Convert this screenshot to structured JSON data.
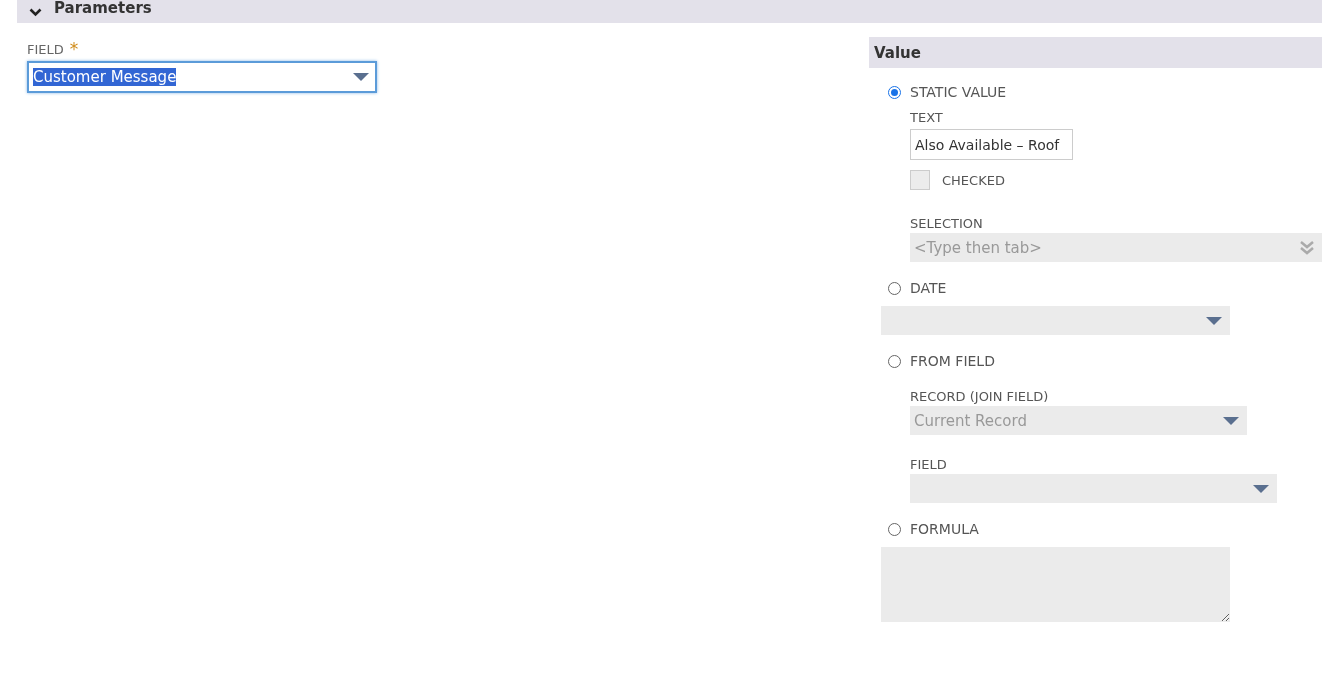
{
  "section": {
    "title": "Parameters",
    "expanded": true
  },
  "field": {
    "label": "FIELD",
    "required": true,
    "required_mark": "*",
    "value": "Customer Message",
    "highlighted": true
  },
  "value_panel": {
    "title": "Value",
    "options": [
      {
        "kind": "static",
        "label": "STATIC VALUE",
        "selected": true,
        "fields": [
          {
            "kind": "text",
            "label": "TEXT",
            "value": "Also Available – Roof"
          },
          {
            "kind": "checkbox",
            "label": "CHECKED",
            "checked": false
          },
          {
            "kind": "multiselect",
            "label": "SELECTION",
            "placeholder": "<Type then tab>"
          }
        ]
      },
      {
        "kind": "date",
        "label": "DATE",
        "selected": false,
        "fields": [
          {
            "kind": "dropdown"
          }
        ]
      },
      {
        "kind": "from_field",
        "label": "FROM FIELD",
        "selected": false,
        "fields": [
          {
            "kind": "dropdown",
            "label": "RECORD (JOIN FIELD)",
            "placeholder": "Current Record"
          },
          {
            "kind": "dropdown",
            "label": "FIELD"
          }
        ]
      },
      {
        "kind": "formula",
        "label": "FORMULA",
        "selected": false,
        "fields": [
          {
            "kind": "textarea"
          }
        ]
      }
    ]
  }
}
